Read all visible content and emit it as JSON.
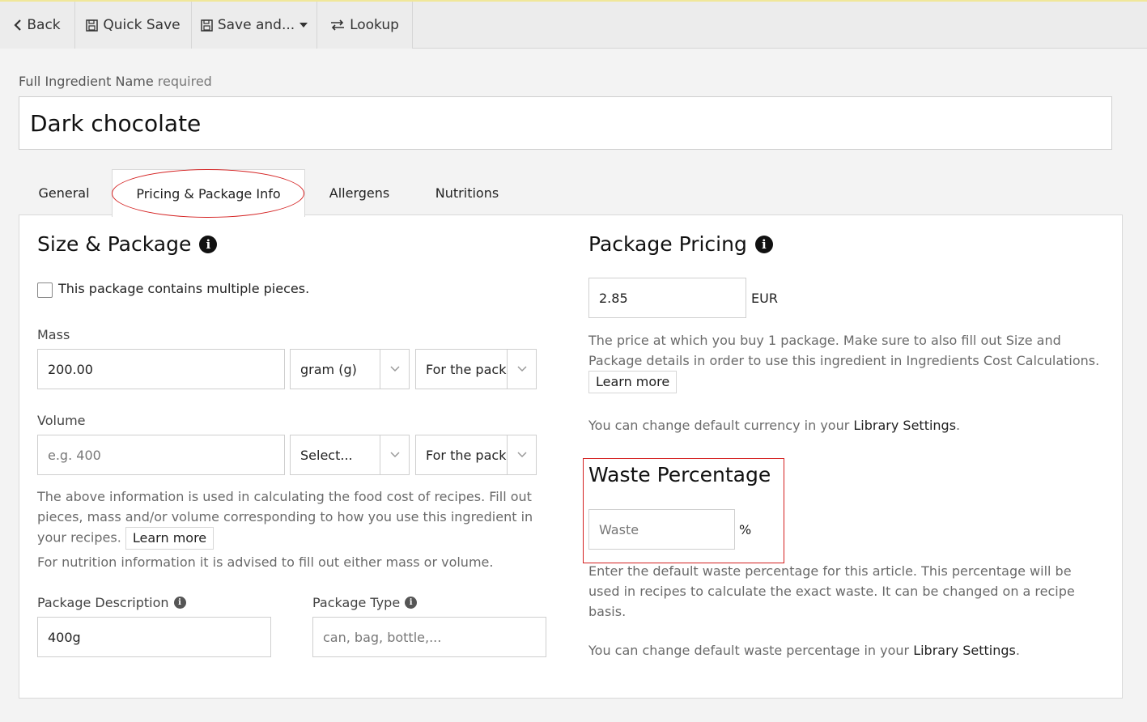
{
  "toolbar": {
    "back_label": "Back",
    "quick_save_label": "Quick Save",
    "save_and_label": "Save and...",
    "lookup_label": "Lookup"
  },
  "ingredient": {
    "name_label": "Full Ingredient Name",
    "name_required": "required",
    "name_value": "Dark chocolate"
  },
  "tabs": [
    {
      "label": "General"
    },
    {
      "label": "Pricing & Package Info",
      "active": true
    },
    {
      "label": "Allergens"
    },
    {
      "label": "Nutritions"
    }
  ],
  "size_package": {
    "title": "Size & Package",
    "multiple_pieces_label": "This package contains multiple pieces.",
    "multiple_pieces_checked": false,
    "mass_label": "Mass",
    "mass_value": "200.00",
    "mass_unit": "gram (g)",
    "mass_for": "For the package",
    "volume_label": "Volume",
    "volume_placeholder": "e.g. 400",
    "volume_unit": "Select...",
    "volume_for": "For the package",
    "info_text": "The above information is used in calculating the food cost of recipes. Fill out pieces, mass and/or volume corresponding to how you use this ingredient in your recipes.",
    "learn_more": "Learn more",
    "nutrition_note": "For nutrition information it is advised to fill out either mass or volume.",
    "package_description_label": "Package Description",
    "package_description_value": "400g",
    "package_type_label": "Package Type",
    "package_type_placeholder": "can, bag, bottle,..."
  },
  "package_pricing": {
    "title": "Package Pricing",
    "price_value": "2.85",
    "currency": "EUR",
    "info_text": "The price at which you buy 1 package. Make sure to also fill out Size and Package details in order to use this ingredient in Ingredients Cost Calculations.",
    "learn_more": "Learn more",
    "currency_note_prefix": "You can change default currency in your",
    "currency_note_link": "Library Settings",
    "currency_note_suffix": "."
  },
  "waste": {
    "title": "Waste Percentage",
    "placeholder": "Waste",
    "unit": "%",
    "info_text": "Enter the default waste percentage for this article. This percentage will be used in recipes to calculate the exact waste. It can be changed on a recipe basis.",
    "note_prefix": "You can change default waste percentage in your",
    "note_link": "Library Settings",
    "note_suffix": "."
  },
  "colors": {
    "annotation_red": "#d42020",
    "toolbar_bg": "#ececec",
    "panel_bg": "#ffffff"
  }
}
